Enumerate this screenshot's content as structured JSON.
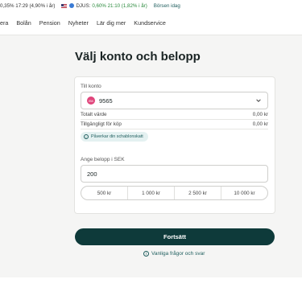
{
  "ticker": {
    "first": "0,35% 17:29 (4,90% i år)",
    "second_name": "DJUS:",
    "second_value": "0,60% 21:10 (1,82% i år)",
    "link": "Börsen idag"
  },
  "nav": {
    "items": [
      "era",
      "Bolån",
      "Pension",
      "Nyheter",
      "Lär dig mer",
      "Kundservice"
    ]
  },
  "page": {
    "title": "Välj konto och belopp"
  },
  "form": {
    "to_account_label": "Till konto",
    "account_badge": "ISK",
    "account_number": "9565",
    "total_value_label": "Totalt värde",
    "total_value": "0,00 kr",
    "available_label": "Tillgängligt för köp",
    "available_value": "0,00 kr",
    "pill_text": "Påverkar din schablonskatt",
    "amount_label": "Ange belopp i SEK",
    "amount_value": "200",
    "quick_amounts": [
      "500 kr",
      "1 000 kr",
      "2 500 kr",
      "10 000 kr"
    ]
  },
  "actions": {
    "continue_label": "Fortsätt",
    "faq_label": "Vanliga frågor och svar"
  },
  "colors": {
    "accent": "#0e3a3a",
    "link": "#1f5e5e",
    "positive": "#2a8a3c",
    "account_badge": "#e0457b"
  }
}
